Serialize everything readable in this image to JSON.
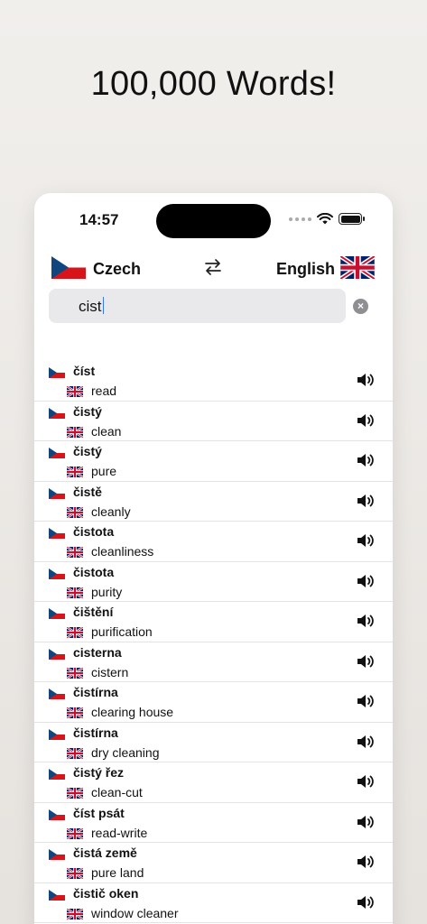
{
  "headline": "100,000 Words!",
  "status": {
    "time": "14:57"
  },
  "languages": {
    "source": "Czech",
    "target": "English"
  },
  "search": {
    "value": "cist"
  },
  "colors": {
    "accent": "#3478f6",
    "cz_blue": "#11457e",
    "cz_red": "#d7141a",
    "uk_blue": "#012169",
    "uk_red": "#c8102e"
  },
  "results": [
    {
      "cz": "číst",
      "en": "read"
    },
    {
      "cz": "čistý",
      "en": "clean"
    },
    {
      "cz": "čistý",
      "en": "pure"
    },
    {
      "cz": "čistě",
      "en": "cleanly"
    },
    {
      "cz": "čistota",
      "en": "cleanliness"
    },
    {
      "cz": "čistota",
      "en": "purity"
    },
    {
      "cz": "čištění",
      "en": "purification"
    },
    {
      "cz": "cisterna",
      "en": "cistern"
    },
    {
      "cz": "čistírna",
      "en": "clearing house"
    },
    {
      "cz": "čistírna",
      "en": "dry cleaning"
    },
    {
      "cz": "čistý řez",
      "en": "clean-cut"
    },
    {
      "cz": "číst psát",
      "en": "read-write"
    },
    {
      "cz": "čistá země",
      "en": "pure land"
    },
    {
      "cz": "čistič oken",
      "en": "window cleaner"
    }
  ]
}
